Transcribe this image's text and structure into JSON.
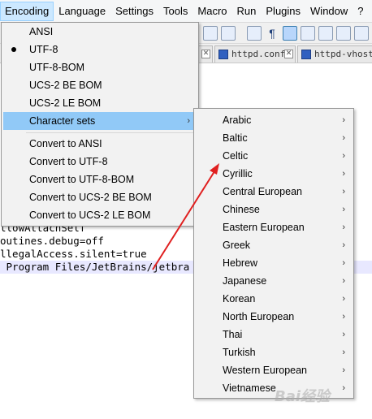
{
  "menubar": {
    "items": [
      "Encoding",
      "Language",
      "Settings",
      "Tools",
      "Macro",
      "Run",
      "Plugins",
      "Window",
      "?"
    ]
  },
  "tabs": [
    {
      "label": "httpd.conf"
    },
    {
      "label": "httpd-vhosts"
    }
  ],
  "editor": {
    "lines": [
      "llowAttachSelf",
      "outines.debug=off",
      "llegalAccess.silent=true",
      " Program Files/JetBrains/jetbra"
    ]
  },
  "encoding_menu": {
    "group1": [
      {
        "label": "ANSI",
        "selected": false
      },
      {
        "label": "UTF-8",
        "selected": true
      },
      {
        "label": "UTF-8-BOM",
        "selected": false
      },
      {
        "label": "UCS-2 BE BOM",
        "selected": false
      },
      {
        "label": "UCS-2 LE BOM",
        "selected": false
      }
    ],
    "character_sets": {
      "label": "Character sets",
      "arrow": "›"
    },
    "group2": [
      {
        "label": "Convert to ANSI"
      },
      {
        "label": "Convert to UTF-8"
      },
      {
        "label": "Convert to UTF-8-BOM"
      },
      {
        "label": "Convert to UCS-2 BE BOM"
      },
      {
        "label": "Convert to UCS-2 LE BOM"
      }
    ]
  },
  "charset_menu": {
    "arrow": "›",
    "items": [
      "Arabic",
      "Baltic",
      "Celtic",
      "Cyrillic",
      "Central European",
      "Chinese",
      "Eastern European",
      "Greek",
      "Hebrew",
      "Japanese",
      "Korean",
      "North European",
      "Thai",
      "Turkish",
      "Western European",
      "Vietnamese"
    ]
  },
  "colors": {
    "active_menu_bg": "#cce8ff",
    "hover_bg": "#91c9f7",
    "annotation_arrow": "#e02020"
  },
  "watermark": {
    "text": "Bai经验"
  }
}
